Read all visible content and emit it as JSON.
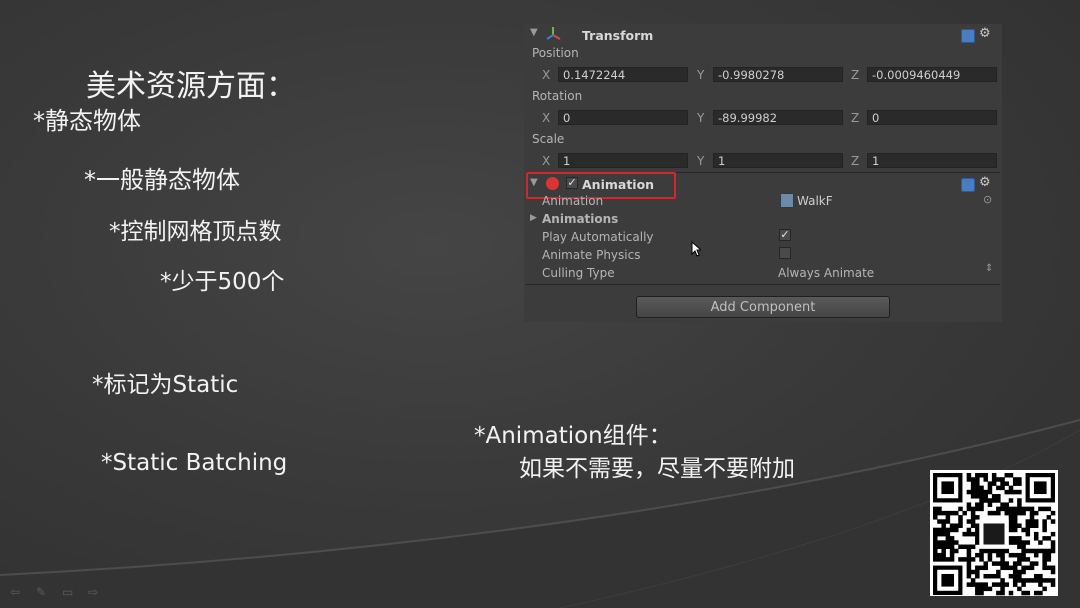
{
  "slide": {
    "title": "美术资源方面：",
    "bullets": {
      "static_objects": "*静态物体",
      "general_static": "*一般静态物体",
      "control_vertices": "*控制网格顶点数",
      "less_than_500": "*少于500个",
      "mark_static": "*标记为Static",
      "static_batching": "*Static Batching",
      "animation_component": "*Animation组件：",
      "animation_advice": "如果不需要，尽量不要附加"
    }
  },
  "inspector": {
    "transform": {
      "header": "Transform",
      "position_label": "Position",
      "rotation_label": "Rotation",
      "scale_label": "Scale",
      "axis_x": "X",
      "axis_y": "Y",
      "axis_z": "Z",
      "position": {
        "x": "0.1472244",
        "y": "-0.9980278",
        "z": "-0.0009460449"
      },
      "rotation": {
        "x": "0",
        "y": "-89.99982",
        "z": "0"
      },
      "scale": {
        "x": "1",
        "y": "1",
        "z": "1"
      }
    },
    "animation": {
      "header": "Animation",
      "enabled": true,
      "animation_label": "Animation",
      "animation_value": "WalkF",
      "animations_label": "Animations",
      "play_automatically_label": "Play Automatically",
      "play_automatically": true,
      "animate_physics_label": "Animate Physics",
      "animate_physics": false,
      "culling_type_label": "Culling Type",
      "culling_type_value": "Always Animate"
    },
    "add_component_label": "Add Component"
  },
  "colors": {
    "highlight_border": "#d5252f",
    "inspector_bg": "#3c3c3c",
    "slide_text": "#f2f2f2"
  }
}
